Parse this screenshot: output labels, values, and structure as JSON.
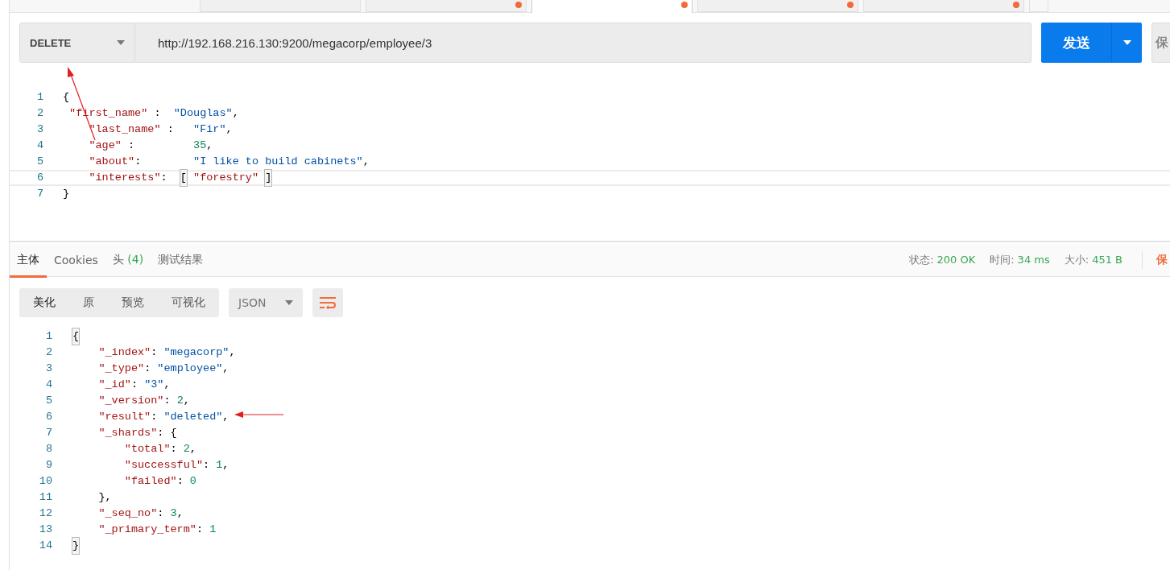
{
  "request_tabs": [
    {
      "selected": false,
      "unsaved": false
    },
    {
      "selected": false,
      "unsaved": true
    },
    {
      "selected": true,
      "unsaved": true
    },
    {
      "selected": false,
      "unsaved": true
    },
    {
      "selected": false,
      "unsaved": true
    }
  ],
  "request": {
    "method": "DELETE",
    "url": "http://192.168.216.130:9200/megacorp/employee/3",
    "send_label": "发送",
    "save_label": "保"
  },
  "request_body": {
    "line_numbers": [
      "1",
      "2",
      "3",
      "4",
      "5",
      "6",
      "7"
    ],
    "lines": [
      {
        "active": false,
        "tokens": [
          {
            "kind": "punct",
            "text": "{"
          }
        ]
      },
      {
        "active": false,
        "tokens": [
          {
            "kind": "key",
            "text": " \"first_name\""
          },
          {
            "kind": "punct",
            "text": " :  "
          },
          {
            "kind": "string",
            "text": "\"Douglas\""
          },
          {
            "kind": "punct",
            "text": ","
          }
        ]
      },
      {
        "active": false,
        "tokens": [
          {
            "kind": "key",
            "text": "    \"last_name\""
          },
          {
            "kind": "punct",
            "text": " :   "
          },
          {
            "kind": "string",
            "text": "\"Fir\""
          },
          {
            "kind": "punct",
            "text": ","
          }
        ]
      },
      {
        "active": false,
        "tokens": [
          {
            "kind": "key",
            "text": "    \"age\""
          },
          {
            "kind": "punct",
            "text": " :         "
          },
          {
            "kind": "number",
            "text": "35"
          },
          {
            "kind": "punct",
            "text": ","
          }
        ]
      },
      {
        "active": false,
        "tokens": [
          {
            "kind": "key",
            "text": "    \"about\""
          },
          {
            "kind": "punct",
            "text": ":        "
          },
          {
            "kind": "string",
            "text": "\"I like to build cabinets\""
          },
          {
            "kind": "punct",
            "text": ","
          }
        ]
      },
      {
        "active": true,
        "tokens": [
          {
            "kind": "key",
            "text": "    \"interests\""
          },
          {
            "kind": "punct",
            "text": ":  "
          },
          {
            "kind": "match",
            "text": "["
          },
          {
            "kind": "key",
            "text": " \"forestry\" "
          },
          {
            "kind": "match",
            "text": "]"
          }
        ]
      },
      {
        "active": false,
        "tokens": [
          {
            "kind": "punct",
            "text": "}"
          }
        ]
      }
    ]
  },
  "response_tabs": [
    {
      "label": "主体",
      "selected": true
    },
    {
      "label": "Cookies",
      "selected": false
    },
    {
      "label": "头",
      "count": "(4)",
      "selected": false
    },
    {
      "label": "测试结果",
      "selected": false
    }
  ],
  "response_meta": [
    {
      "label": "状态:",
      "value": "200 OK"
    },
    {
      "label": "时间:",
      "value": "34 ms"
    },
    {
      "label": "大小:",
      "value": "451 B"
    }
  ],
  "response_save_label": "保",
  "view_modes": [
    {
      "label": "美化",
      "selected": true
    },
    {
      "label": "原",
      "selected": false
    },
    {
      "label": "预览",
      "selected": false
    },
    {
      "label": "可视化",
      "selected": false
    }
  ],
  "format": "JSON",
  "response_body": {
    "line_numbers": [
      "1",
      "2",
      "3",
      "4",
      "5",
      "6",
      "7",
      "8",
      "9",
      "10",
      "11",
      "12",
      "13",
      "14"
    ],
    "lines": [
      {
        "active": false,
        "tokens": [
          {
            "kind": "match",
            "text": "{"
          }
        ]
      },
      {
        "active": false,
        "tokens": [
          {
            "kind": "key",
            "text": "    \"_index\""
          },
          {
            "kind": "punct",
            "text": ": "
          },
          {
            "kind": "string",
            "text": "\"megacorp\""
          },
          {
            "kind": "punct",
            "text": ","
          }
        ]
      },
      {
        "active": false,
        "tokens": [
          {
            "kind": "key",
            "text": "    \"_type\""
          },
          {
            "kind": "punct",
            "text": ": "
          },
          {
            "kind": "string",
            "text": "\"employee\""
          },
          {
            "kind": "punct",
            "text": ","
          }
        ]
      },
      {
        "active": false,
        "tokens": [
          {
            "kind": "key",
            "text": "    \"_id\""
          },
          {
            "kind": "punct",
            "text": ": "
          },
          {
            "kind": "string",
            "text": "\"3\""
          },
          {
            "kind": "punct",
            "text": ","
          }
        ]
      },
      {
        "active": false,
        "tokens": [
          {
            "kind": "key",
            "text": "    \"_version\""
          },
          {
            "kind": "punct",
            "text": ": "
          },
          {
            "kind": "number",
            "text": "2"
          },
          {
            "kind": "punct",
            "text": ","
          }
        ]
      },
      {
        "active": false,
        "tokens": [
          {
            "kind": "key",
            "text": "    \"result\""
          },
          {
            "kind": "punct",
            "text": ": "
          },
          {
            "kind": "string",
            "text": "\"deleted\""
          },
          {
            "kind": "punct",
            "text": ","
          }
        ]
      },
      {
        "active": false,
        "tokens": [
          {
            "kind": "key",
            "text": "    \"_shards\""
          },
          {
            "kind": "punct",
            "text": ": {"
          }
        ]
      },
      {
        "active": false,
        "tokens": [
          {
            "kind": "key",
            "text": "        \"total\""
          },
          {
            "kind": "punct",
            "text": ": "
          },
          {
            "kind": "number",
            "text": "2"
          },
          {
            "kind": "punct",
            "text": ","
          }
        ]
      },
      {
        "active": false,
        "tokens": [
          {
            "kind": "key",
            "text": "        \"successful\""
          },
          {
            "kind": "punct",
            "text": ": "
          },
          {
            "kind": "number",
            "text": "1"
          },
          {
            "kind": "punct",
            "text": ","
          }
        ]
      },
      {
        "active": false,
        "tokens": [
          {
            "kind": "key",
            "text": "        \"failed\""
          },
          {
            "kind": "punct",
            "text": ": "
          },
          {
            "kind": "number",
            "text": "0"
          }
        ]
      },
      {
        "active": false,
        "tokens": [
          {
            "kind": "punct",
            "text": "    },"
          }
        ]
      },
      {
        "active": false,
        "tokens": [
          {
            "kind": "key",
            "text": "    \"_seq_no\""
          },
          {
            "kind": "punct",
            "text": ": "
          },
          {
            "kind": "number",
            "text": "3"
          },
          {
            "kind": "punct",
            "text": ","
          }
        ]
      },
      {
        "active": false,
        "tokens": [
          {
            "kind": "key",
            "text": "    \"_primary_term\""
          },
          {
            "kind": "punct",
            "text": ": "
          },
          {
            "kind": "number",
            "text": "1"
          }
        ]
      },
      {
        "active": false,
        "tokens": [
          {
            "kind": "match",
            "text": "}"
          }
        ]
      }
    ]
  }
}
